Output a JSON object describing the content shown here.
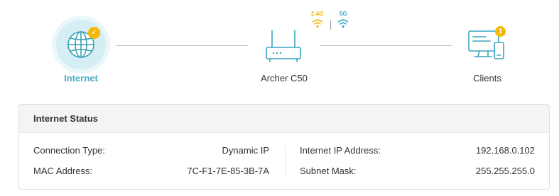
{
  "topology": {
    "internet_label": "Internet",
    "router_label": "Archer C50",
    "clients_label": "Clients",
    "clients_count": "1",
    "band_24": "2.4G",
    "band_5": "5G"
  },
  "colors": {
    "accent": "#4aaec2",
    "band_24": "#f5b800",
    "band_5": "#3aa6c0",
    "badge": "#f5b800"
  },
  "icons": {
    "internet": "globe-icon",
    "connected": "check-badge-icon",
    "router": "router-icon",
    "wifi": "wifi-icon",
    "clients": "monitor-phone-icon"
  },
  "status": {
    "title": "Internet Status",
    "connection_type_label": "Connection Type:",
    "connection_type_value": "Dynamic IP",
    "mac_label": "MAC Address:",
    "mac_value": "7C-F1-7E-85-3B-7A",
    "ip_label": "Internet IP Address:",
    "ip_value": "192.168.0.102",
    "mask_label": "Subnet Mask:",
    "mask_value": "255.255.255.0"
  }
}
